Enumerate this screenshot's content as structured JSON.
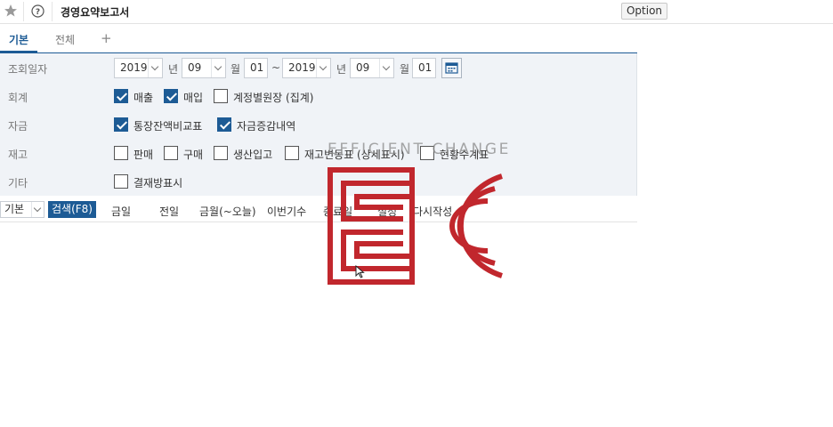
{
  "header": {
    "title": "경영요약보고서",
    "option_label": "Option"
  },
  "tabs": [
    {
      "label": "기본"
    },
    {
      "label": "전체"
    }
  ],
  "tab_add": "+",
  "filters": {
    "period": {
      "label": "조회일자",
      "from_year": "2019",
      "year_unit": "년",
      "from_month": "09",
      "month_unit": "월",
      "from_day": "01",
      "range_sep": "~",
      "to_year": "2019",
      "to_month": "09",
      "to_day": "01"
    },
    "accounting": {
      "label": "회계",
      "options": [
        {
          "label": "매출",
          "checked": true
        },
        {
          "label": "매입",
          "checked": true
        },
        {
          "label": "계정별원장 (집계)",
          "checked": false
        }
      ]
    },
    "funds": {
      "label": "자금",
      "options": [
        {
          "label": "통장잔액비교표",
          "checked": true
        },
        {
          "label": "자금증감내역",
          "checked": true
        }
      ]
    },
    "inventory": {
      "label": "재고",
      "options": [
        {
          "label": "판매",
          "checked": false
        },
        {
          "label": "구매",
          "checked": false
        },
        {
          "label": "생산입고",
          "checked": false
        },
        {
          "label": "재고변동표 (상세표시)",
          "checked": false
        },
        {
          "label": "현황수계표",
          "checked": false
        }
      ]
    },
    "other": {
      "label": "기타",
      "options": [
        {
          "label": "결재방표시",
          "checked": false
        }
      ]
    }
  },
  "toolbar": {
    "preset_value": "기본",
    "search_label": "검색(F8)",
    "links": [
      "금일",
      "전일",
      "금월(~오늘)",
      "이번기수",
      "종료일",
      "설정",
      "다시작성"
    ]
  },
  "watermark": {
    "tagline": "EFFICIENT CHANGE",
    "brand_color": "#c1272d"
  }
}
